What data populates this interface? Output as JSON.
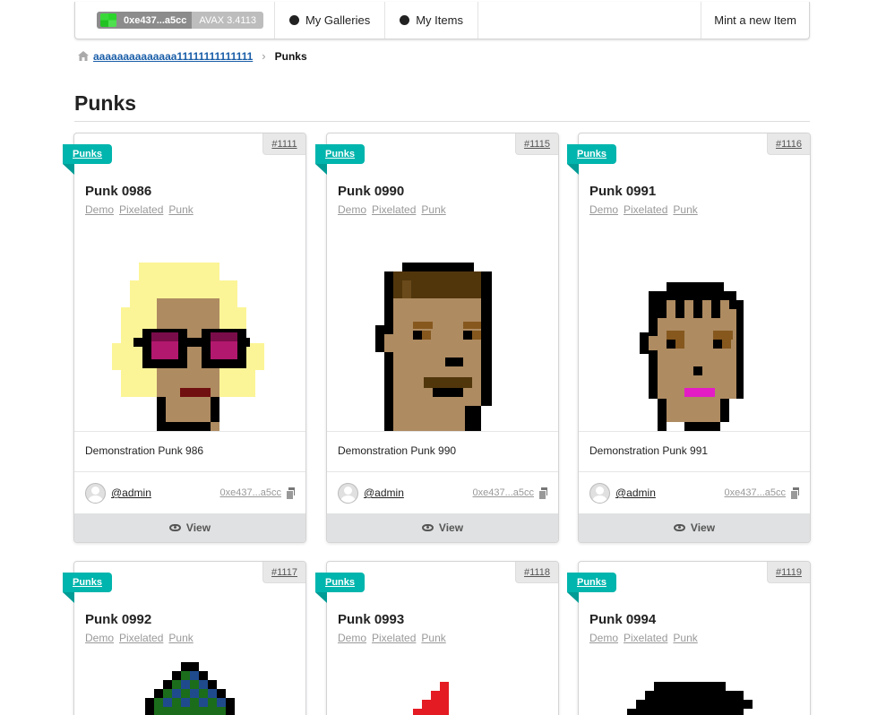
{
  "navbar": {
    "wallet_address": "0xe437...a5cc",
    "wallet_balance": "AVAX 3.4113",
    "my_galleries": "My Galleries",
    "my_items": "My Items",
    "mint": "Mint a new Item"
  },
  "breadcrumb": {
    "parent": "aaaaaaaaaaaaaa11111111111111",
    "separator": "›",
    "current": "Punks"
  },
  "page_title": "Punks",
  "cards": [
    {
      "id": "#1111",
      "ribbon": "Punks",
      "title": "Punk 0986",
      "tags": [
        "Demo",
        "Pixelated",
        "Punk"
      ],
      "description": "Demonstration Punk 986",
      "owner": "@admin",
      "owner_address": "0xe437...a5cc",
      "view": "View"
    },
    {
      "id": "#1115",
      "ribbon": "Punks",
      "title": "Punk 0990",
      "tags": [
        "Demo",
        "Pixelated",
        "Punk"
      ],
      "description": "Demonstration Punk 990",
      "owner": "@admin",
      "owner_address": "0xe437...a5cc",
      "view": "View"
    },
    {
      "id": "#1116",
      "ribbon": "Punks",
      "title": "Punk 0991",
      "tags": [
        "Demo",
        "Pixelated",
        "Punk"
      ],
      "description": "Demonstration Punk 991",
      "owner": "@admin",
      "owner_address": "0xe437...a5cc",
      "view": "View"
    },
    {
      "id": "#1117",
      "ribbon": "Punks",
      "title": "Punk 0992",
      "tags": [
        "Demo",
        "Pixelated",
        "Punk"
      ]
    },
    {
      "id": "#1118",
      "ribbon": "Punks",
      "title": "Punk 0993",
      "tags": [
        "Demo",
        "Pixelated",
        "Punk"
      ]
    },
    {
      "id": "#1119",
      "ribbon": "Punks",
      "title": "Punk 0994",
      "tags": [
        "Demo",
        "Pixelated",
        "Punk"
      ]
    }
  ],
  "colors": {
    "ribbon": "#00b5ad",
    "link": "#1a5ea8",
    "skin": "#ae8b61",
    "wallet_avatar": "#2bd52b"
  }
}
